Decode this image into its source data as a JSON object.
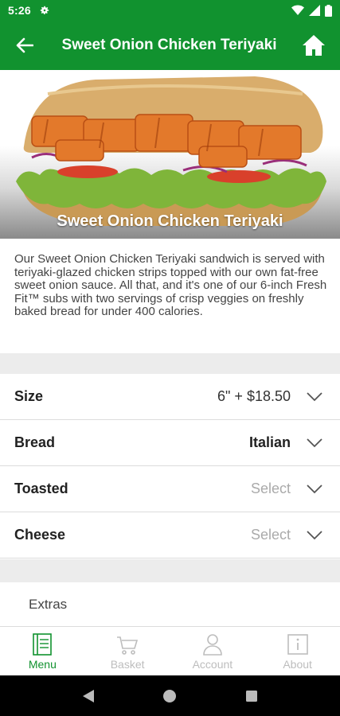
{
  "status_bar": {
    "time": "5:26",
    "icons": [
      "settings-icon",
      "wifi-icon",
      "signal-icon",
      "battery-icon"
    ]
  },
  "app_bar": {
    "title": "Sweet Onion Chicken Teriyaki",
    "back_icon": "back-arrow-icon",
    "home_icon": "home-icon",
    "color": "#11922f"
  },
  "hero": {
    "caption": "Sweet Onion Chicken Teriyaki"
  },
  "description": "Our Sweet Onion Chicken Teriyaki sandwich is served with teriyaki-glazed chicken strips topped with our own fat-free sweet onion sauce. All that, and it's one of our 6-inch Fresh Fit™ subs with two servings of crisp veggies on freshly baked bread for under 400 calories.",
  "options": [
    {
      "label": "Size",
      "value": "6\"  + $18.50",
      "style": "normal"
    },
    {
      "label": "Bread",
      "value": "Italian",
      "style": "bold"
    },
    {
      "label": "Toasted",
      "value": "Select",
      "style": "placeholder"
    },
    {
      "label": "Cheese",
      "value": "Select",
      "style": "placeholder"
    }
  ],
  "extras_label": "Extras",
  "bottom_nav": [
    {
      "label": "Menu",
      "icon": "menu-icon",
      "active": true
    },
    {
      "label": "Basket",
      "icon": "basket-icon",
      "active": false
    },
    {
      "label": "Account",
      "icon": "account-icon",
      "active": false
    },
    {
      "label": "About",
      "icon": "info-icon",
      "active": false
    }
  ],
  "colors": {
    "brand_green": "#11922f",
    "inactive_nav": "#bdbdbd"
  }
}
